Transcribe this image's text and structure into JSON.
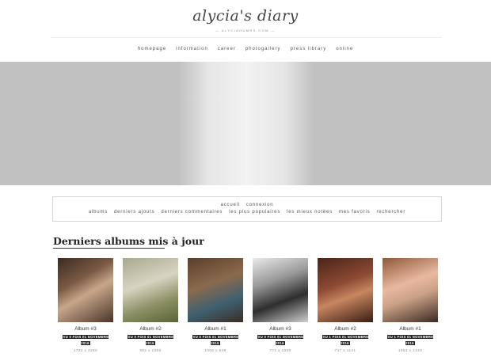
{
  "header": {
    "logo": "alycia's diary",
    "tagline": "— ALYCIAHUMRS.COM —"
  },
  "main_nav": [
    "homepage",
    "information",
    "career",
    "photogallery",
    "press library",
    "online"
  ],
  "subnav": {
    "row1": [
      "accueil",
      "connexion"
    ],
    "row2": [
      "albums",
      "derniers ajouts",
      "derniers commentaires",
      "les plus populaires",
      "les mieux notées",
      "mes favoris",
      "rechercher"
    ]
  },
  "section_title": "Derniers albums mis à jour",
  "albums": [
    {
      "name": "Album #3",
      "views": "VU 0 FOIS 01 NOVEMBRE 2016",
      "dims": "1732 x 2250"
    },
    {
      "name": "Album #2",
      "views": "VU 0 FOIS 01 NOVEMBRE 2016",
      "dims": "982 x 1300"
    },
    {
      "name": "Album #1",
      "views": "VU 0 FOIS 01 NOVEMBRE 2016",
      "dims": "1006 x 849"
    },
    {
      "name": "Album #3",
      "views": "VU 0 FOIS 01 NOVEMBRE 2016",
      "dims": "771 x 1000"
    },
    {
      "name": "Album #2",
      "views": "VU 1 FOIS 01 NOVEMBRE 2016",
      "dims": "747 x 1121"
    },
    {
      "name": "Album #1",
      "views": "VU 1 FOIS 01 NOVEMBRE 2016",
      "dims": "1063 x 1440"
    }
  ]
}
